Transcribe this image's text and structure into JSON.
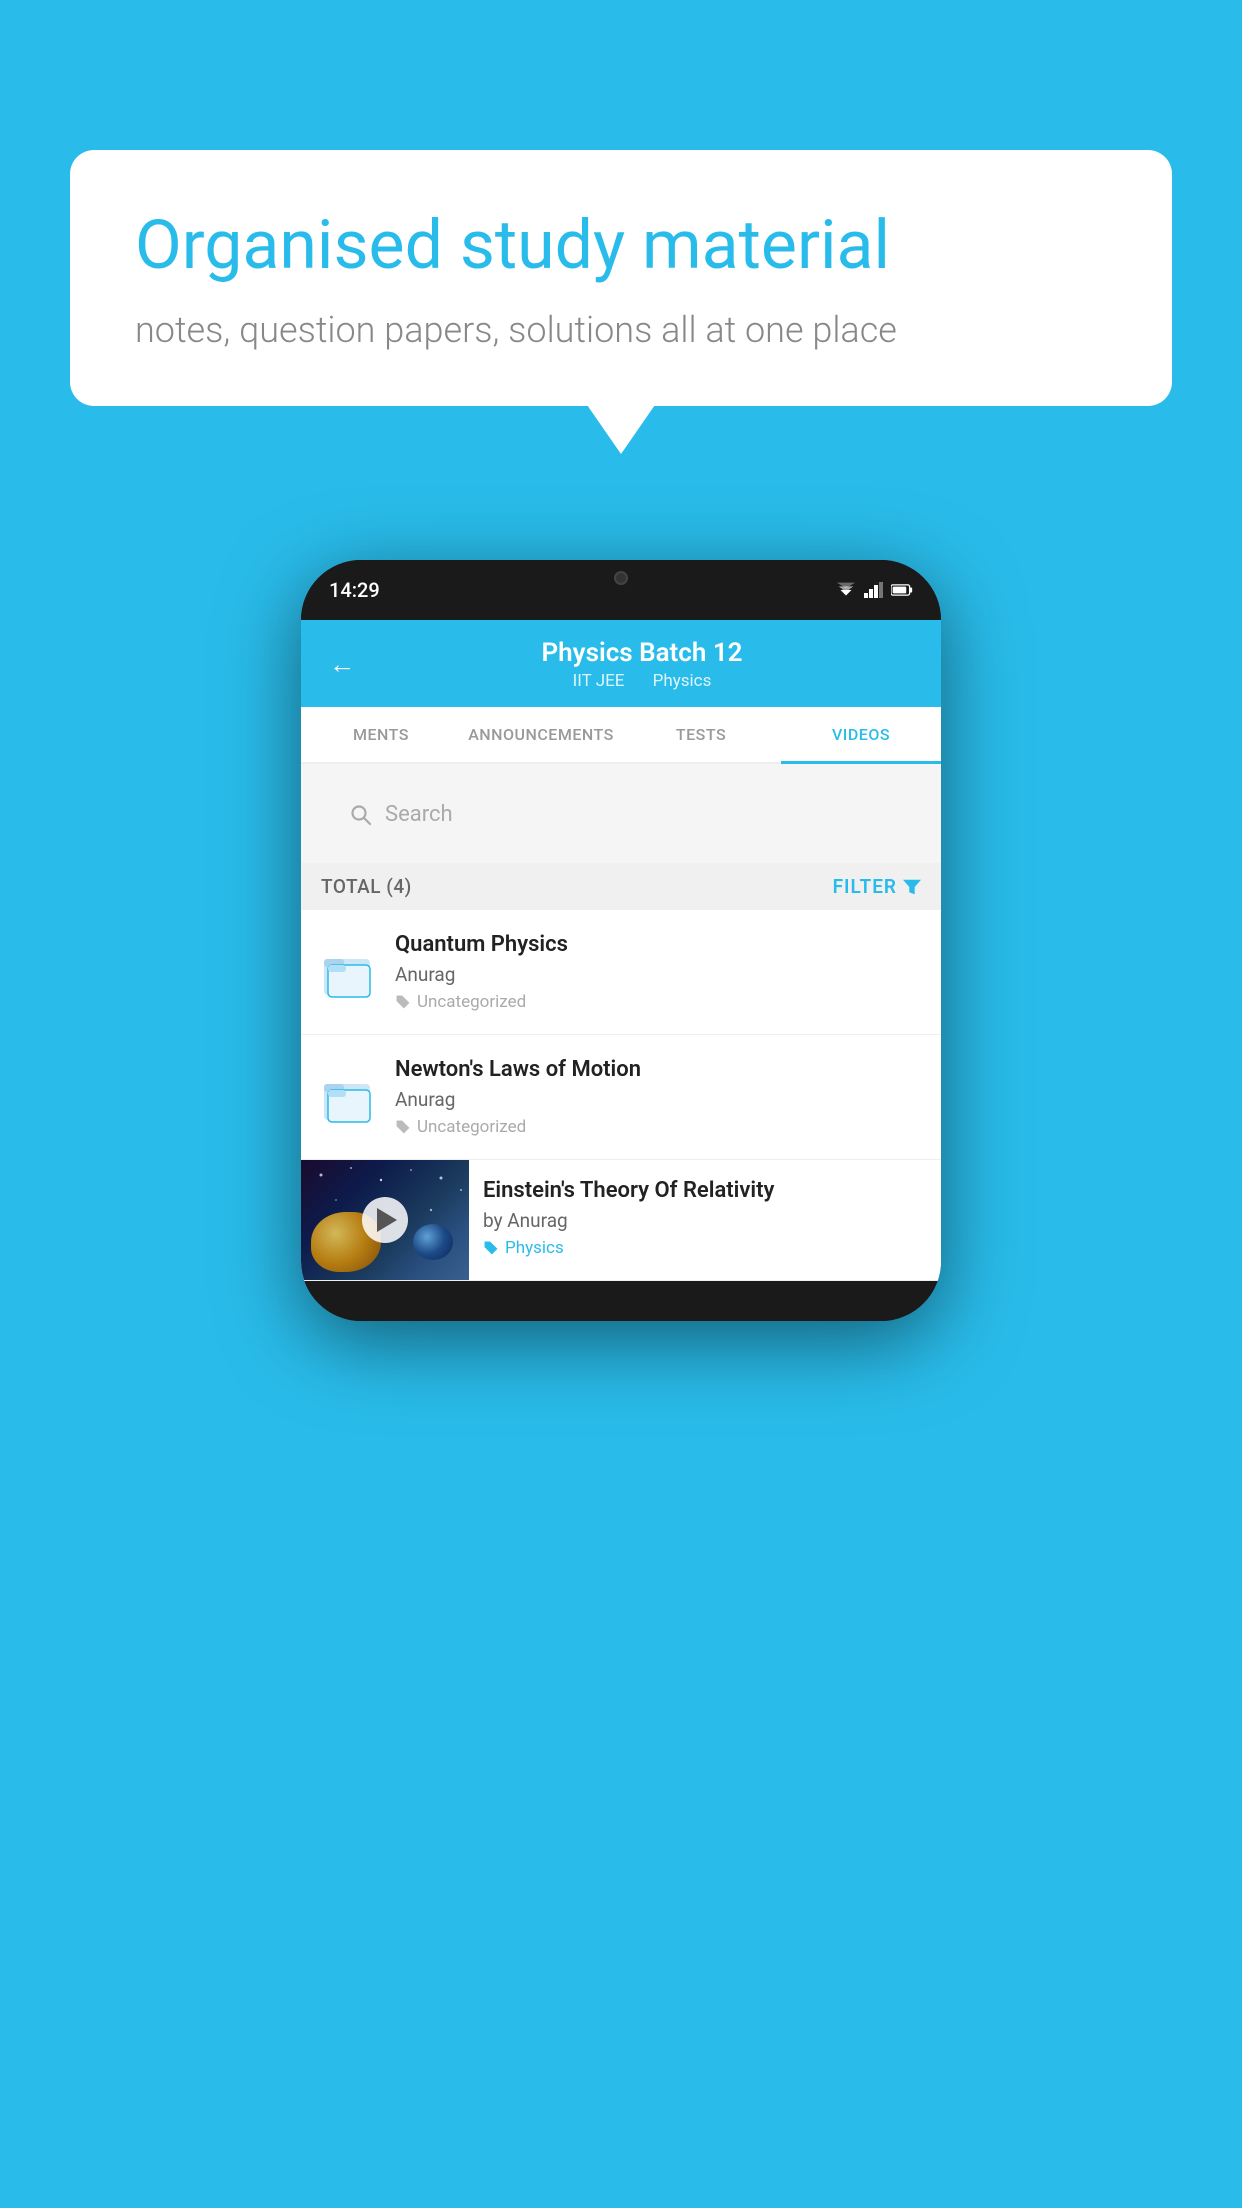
{
  "background_color": "#29BCEA",
  "speech_bubble": {
    "heading": "Organised study material",
    "subtitle": "notes, question papers, solutions all at one place"
  },
  "phone": {
    "status_bar": {
      "time": "14:29"
    },
    "header": {
      "title": "Physics Batch 12",
      "subtitle_part1": "IIT JEE",
      "subtitle_part2": "Physics",
      "back_label": "←"
    },
    "tabs": [
      {
        "label": "MENTS",
        "active": false
      },
      {
        "label": "ANNOUNCEMENTS",
        "active": false
      },
      {
        "label": "TESTS",
        "active": false
      },
      {
        "label": "VIDEOS",
        "active": true
      }
    ],
    "search": {
      "placeholder": "Search"
    },
    "filter_row": {
      "total_label": "TOTAL (4)",
      "filter_label": "FILTER"
    },
    "videos": [
      {
        "id": 1,
        "title": "Quantum Physics",
        "author": "Anurag",
        "tag": "Uncategorized",
        "has_thumbnail": false
      },
      {
        "id": 2,
        "title": "Newton's Laws of Motion",
        "author": "Anurag",
        "tag": "Uncategorized",
        "has_thumbnail": false
      },
      {
        "id": 3,
        "title": "Einstein's Theory Of Relativity",
        "author": "by Anurag",
        "tag": "Physics",
        "has_thumbnail": true
      }
    ]
  }
}
